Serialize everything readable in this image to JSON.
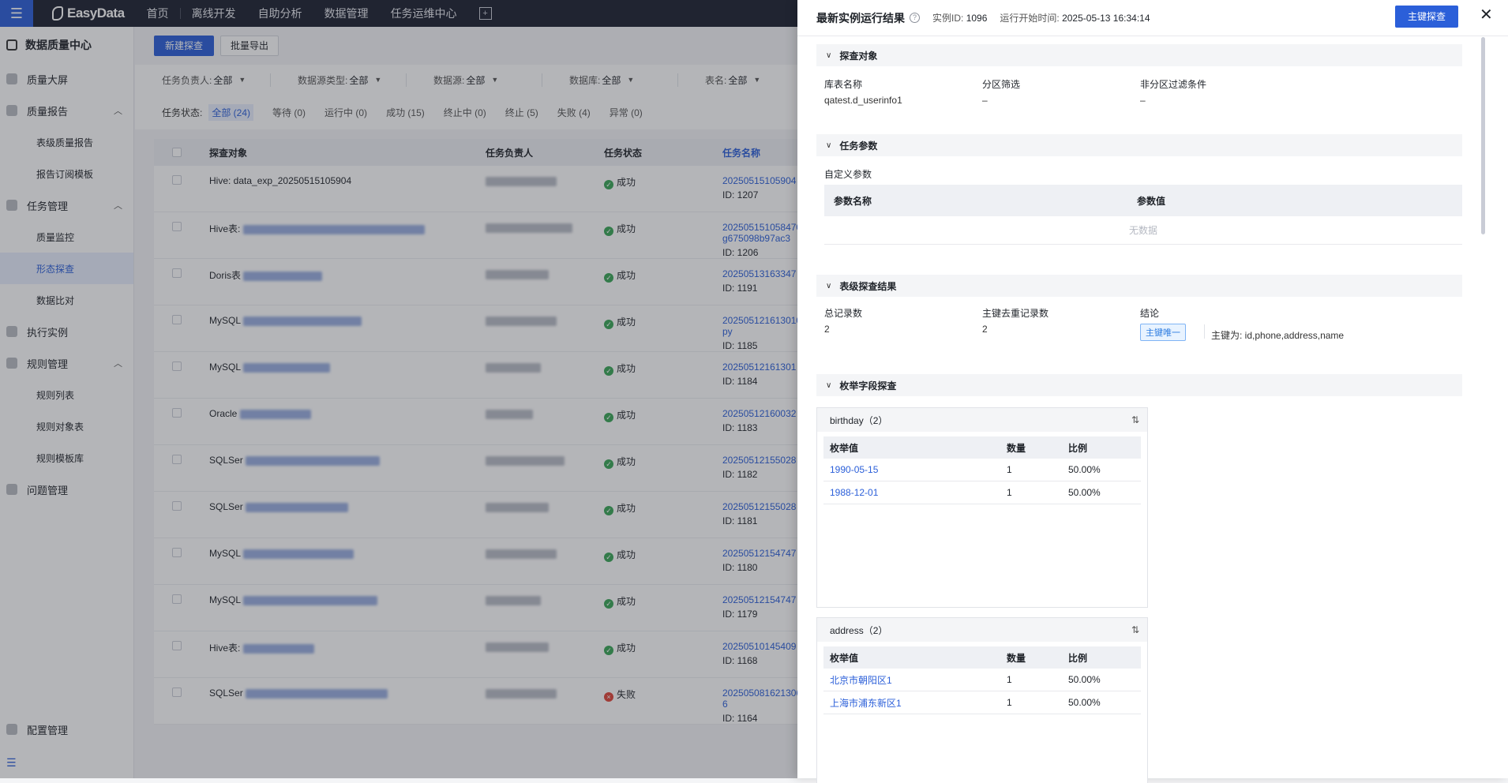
{
  "topbar": {
    "logo": "EasyData",
    "nav": [
      "首页",
      "离线开发",
      "自助分析",
      "数据管理",
      "任务运维中心"
    ]
  },
  "sidebar": {
    "title": "数据质量中心",
    "items": [
      {
        "label": "质量大屏"
      },
      {
        "label": "质量报告",
        "children": [
          "表级质量报告",
          "报告订阅模板"
        ]
      },
      {
        "label": "任务管理",
        "children": [
          "质量监控",
          "形态探查",
          "数据比对"
        ]
      },
      {
        "label": "执行实例"
      },
      {
        "label": "规则管理",
        "children": [
          "规则列表",
          "规则对象表",
          "规则模板库"
        ]
      },
      {
        "label": "问题管理"
      }
    ],
    "bottom": "配置管理"
  },
  "toolbar": {
    "new": "新建探查",
    "export": "批量导出"
  },
  "filters": [
    {
      "label": "任务负责人:",
      "value": "全部"
    },
    {
      "label": "数据源类型:",
      "value": "全部"
    },
    {
      "label": "数据源:",
      "value": "全部"
    },
    {
      "label": "数据库:",
      "value": "全部"
    },
    {
      "label": "表名:",
      "value": "全部"
    }
  ],
  "status_filter": {
    "label": "任务状态:",
    "options": [
      "全部 (24)",
      "等待 (0)",
      "运行中 (0)",
      "成功 (15)",
      "终止中 (0)",
      "终止 (5)",
      "失败 (4)",
      "异常 (0)"
    ]
  },
  "table": {
    "headers": [
      "探查对象",
      "任务负责人",
      "任务状态",
      "任务名称"
    ],
    "rows": [
      {
        "obj": "Hive: data_exp_20250515105904",
        "status": "成功",
        "name": "20250515105904",
        "id": "ID: 1207"
      },
      {
        "obj": "Hive表:",
        "status": "成功",
        "name": "202505151058470",
        "name2": "g675098b97ac3",
        "id": "ID: 1206"
      },
      {
        "obj": "Doris表",
        "status": "成功",
        "name": "20250513163347",
        "id": "ID: 1191"
      },
      {
        "obj": "MySQL",
        "status": "成功",
        "name": "202505121613010",
        "name2": "py",
        "id": "ID: 1185"
      },
      {
        "obj": "MySQL",
        "status": "成功",
        "name": "20250512161301",
        "id": "ID: 1184"
      },
      {
        "obj": "Oracle",
        "status": "成功",
        "name": "20250512160032",
        "id": "ID: 1183"
      },
      {
        "obj": "SQLSer",
        "status": "成功",
        "name": "20250512155028",
        "id": "ID: 1182"
      },
      {
        "obj": "SQLSer",
        "status": "成功",
        "name": "20250512155028",
        "id": "ID: 1181"
      },
      {
        "obj": "MySQL",
        "status": "成功",
        "name": "20250512154747",
        "id": "ID: 1180"
      },
      {
        "obj": "MySQL",
        "status": "成功",
        "name": "20250512154747",
        "id": "ID: 1179"
      },
      {
        "obj": "Hive表:",
        "status": "成功",
        "name": "20250510145409",
        "id": "ID: 1168"
      },
      {
        "obj": "SQLSer",
        "status": "失败",
        "name": "202505081621306",
        "name2": "6",
        "id": "ID: 1164"
      }
    ]
  },
  "drawer": {
    "title": "最新实例运行结果",
    "instance_label": "实例ID:",
    "instance_id": "1096",
    "start_label": "运行开始时间:",
    "start_time": "2025-05-13 16:34:14",
    "pk_button": "主键探查",
    "sections": {
      "object": {
        "title": "探查对象",
        "fields": [
          {
            "label": "库表名称",
            "value": "qatest.d_userinfo1"
          },
          {
            "label": "分区筛选",
            "value": "–"
          },
          {
            "label": "非分区过滤条件",
            "value": "–"
          }
        ]
      },
      "params": {
        "title": "任务参数",
        "sub": "自定义参数",
        "headers": [
          "参数名称",
          "参数值"
        ],
        "empty": "无数据"
      },
      "table_result": {
        "title": "表级探查结果",
        "fields": [
          {
            "label": "总记录数",
            "value": "2"
          },
          {
            "label": "主键去重记录数",
            "value": "2"
          },
          {
            "label": "结论",
            "value": ""
          }
        ],
        "tag": "主键唯一",
        "pk_text": "主键为: id,phone,address,name"
      },
      "enum": {
        "title": "枚举字段探查",
        "headers": [
          "枚举值",
          "数量",
          "比例"
        ],
        "fields": [
          {
            "name": "birthday（2）",
            "rows": [
              {
                "value": "1990-05-15",
                "count": "1",
                "ratio": "50.00%"
              },
              {
                "value": "1988-12-01",
                "count": "1",
                "ratio": "50.00%"
              }
            ]
          },
          {
            "name": "address（2）",
            "rows": [
              {
                "value": "北京市朝阳区1",
                "count": "1",
                "ratio": "50.00%"
              },
              {
                "value": "上海市浦东新区1",
                "count": "1",
                "ratio": "50.00%"
              }
            ]
          }
        ]
      }
    }
  }
}
